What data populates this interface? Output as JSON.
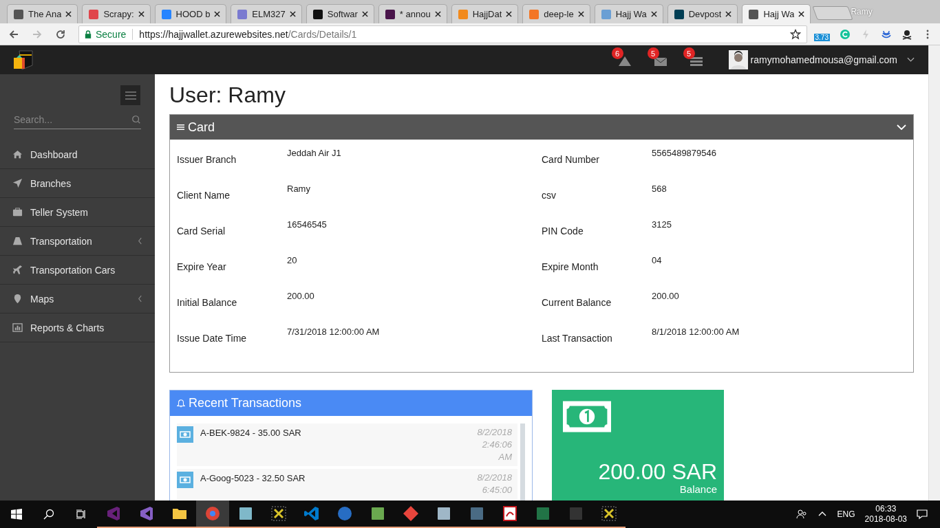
{
  "browser": {
    "tabs": [
      {
        "title": "The Ana",
        "color": "#555555",
        "selected": false
      },
      {
        "title": "Scrapy: ",
        "color": "#e0454b",
        "selected": false
      },
      {
        "title": "HOOD b",
        "color": "#2684ff",
        "selected": false
      },
      {
        "title": "ELM327",
        "color": "#7a7ad0",
        "selected": false
      },
      {
        "title": "Softwar",
        "color": "#111111",
        "selected": false
      },
      {
        "title": "* annou",
        "color": "#4a154b",
        "selected": false
      },
      {
        "title": "HajjDat",
        "color": "#f28a1c",
        "selected": false
      },
      {
        "title": "deep-le",
        "color": "#f37626",
        "selected": false
      },
      {
        "title": "Hajj Wa",
        "color": "#6a9fd4",
        "selected": false
      },
      {
        "title": "Devpost",
        "color": "#003e54",
        "selected": false
      },
      {
        "title": "Hajj Wa",
        "color": "#555555",
        "selected": true
      }
    ],
    "profile": "Ramy",
    "secure_label": "Secure",
    "url_host": "https://hajjwallet.azurewebsites.net",
    "url_path": "/Cards/Details/1",
    "extension_badge": "3.73"
  },
  "header": {
    "alerts": [
      {
        "kind": "warning",
        "count": "6"
      },
      {
        "kind": "mail",
        "count": "5"
      },
      {
        "kind": "tasks",
        "count": "5"
      }
    ],
    "user_email": "ramymohamedmousa@gmail.com"
  },
  "sidebar": {
    "search_placeholder": "Search...",
    "items": [
      {
        "kind": "home",
        "label": "Dashboard",
        "has_submenu": false
      },
      {
        "kind": "location-arrow",
        "label": "Branches",
        "has_submenu": false
      },
      {
        "kind": "briefcase",
        "label": "Teller System",
        "has_submenu": false
      },
      {
        "kind": "road",
        "label": "Transportation",
        "has_submenu": true
      },
      {
        "kind": "plane",
        "label": "Transportation Cars",
        "has_submenu": false
      },
      {
        "kind": "pin",
        "label": "Maps",
        "has_submenu": true
      },
      {
        "kind": "chart",
        "label": "Reports & Charts",
        "has_submenu": false
      }
    ]
  },
  "page_title": "User: Ramy",
  "card": {
    "title": "Card",
    "fields": [
      {
        "label": "Issuer Branch",
        "value": "Jeddah Air J1"
      },
      {
        "label": "Card Number",
        "value": "5565489879546"
      },
      {
        "label": "Client Name",
        "value": "Ramy"
      },
      {
        "label": "csv",
        "value": "568"
      },
      {
        "label": "Card Serial",
        "value": "16546545"
      },
      {
        "label": "PIN Code",
        "value": "3125"
      },
      {
        "label": "Expire Year",
        "value": "20"
      },
      {
        "label": "Expire Month",
        "value": "04"
      },
      {
        "label": "Initial Balance",
        "value": "200.00"
      },
      {
        "label": "Current Balance",
        "value": "200.00"
      },
      {
        "label": "Issue Date Time",
        "value": "7/31/2018 12:00:00 AM"
      },
      {
        "label": "Last Transaction",
        "value": "8/1/2018 12:00:00 AM"
      }
    ]
  },
  "transactions": {
    "title": "Recent Transactions",
    "items": [
      {
        "text": "A-BEK-9824 - 35.00 SAR",
        "time": "8/2/2018 2:46:06 AM"
      },
      {
        "text": "A-Goog-5023 - 32.50 SAR",
        "time": "8/2/2018 6:45:00"
      }
    ]
  },
  "balance_tile": {
    "amount": "200.00 SAR",
    "label": "Balance"
  },
  "taskbar": {
    "apps": [
      {
        "kind": "vs",
        "color": "#68217a"
      },
      {
        "kind": "vs",
        "color": "#865fc5"
      },
      {
        "kind": "folder",
        "color": "#f4c542"
      },
      {
        "kind": "chrome",
        "color": "#db4437"
      },
      {
        "kind": "box",
        "color": "#7fb8c9"
      },
      {
        "kind": "tool",
        "color": "#d8c22a"
      },
      {
        "kind": "vscode",
        "color": "#007acc"
      },
      {
        "kind": "r",
        "color": "#276dc3"
      },
      {
        "kind": "box",
        "color": "#6aa84f"
      },
      {
        "kind": "git",
        "color": "#e8453c"
      },
      {
        "kind": "box",
        "color": "#9fb7c7"
      },
      {
        "kind": "box",
        "color": "#4a6b84"
      },
      {
        "kind": "pdf",
        "color": "#c4161c"
      },
      {
        "kind": "box",
        "color": "#217346"
      },
      {
        "kind": "box",
        "color": "#333333"
      },
      {
        "kind": "tool",
        "color": "#d8c22a"
      }
    ],
    "language": "ENG",
    "time": "06:33",
    "date": "2018-08-03"
  }
}
